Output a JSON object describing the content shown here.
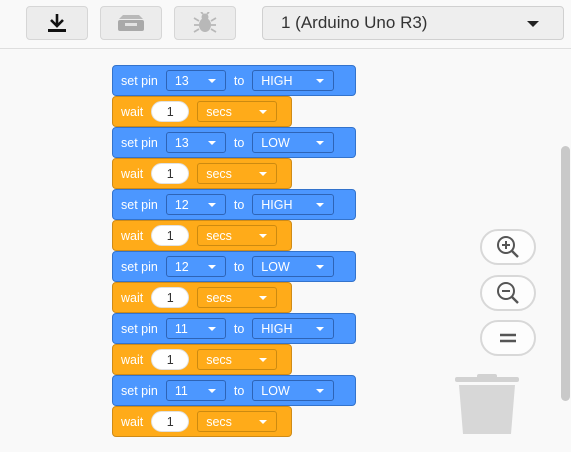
{
  "toolbar": {
    "upload_icon": "download-arrow-icon",
    "serial_icon": "serial-monitor-icon",
    "debug_icon": "bug-icon",
    "device_selector": "1 (Arduino Uno R3)"
  },
  "blocks": [
    {
      "type": "set_pin",
      "label": "set pin",
      "pin": "13",
      "to": "to",
      "state": "HIGH"
    },
    {
      "type": "wait",
      "label": "wait",
      "value": "1",
      "unit": "secs"
    },
    {
      "type": "set_pin",
      "label": "set pin",
      "pin": "13",
      "to": "to",
      "state": "LOW"
    },
    {
      "type": "wait",
      "label": "wait",
      "value": "1",
      "unit": "secs"
    },
    {
      "type": "set_pin",
      "label": "set pin",
      "pin": "12",
      "to": "to",
      "state": "HIGH"
    },
    {
      "type": "wait",
      "label": "wait",
      "value": "1",
      "unit": "secs"
    },
    {
      "type": "set_pin",
      "label": "set pin",
      "pin": "12",
      "to": "to",
      "state": "LOW"
    },
    {
      "type": "wait",
      "label": "wait",
      "value": "1",
      "unit": "secs"
    },
    {
      "type": "set_pin",
      "label": "set pin",
      "pin": "11",
      "to": "to",
      "state": "HIGH"
    },
    {
      "type": "wait",
      "label": "wait",
      "value": "1",
      "unit": "secs"
    },
    {
      "type": "set_pin",
      "label": "set pin",
      "pin": "11",
      "to": "to",
      "state": "LOW"
    },
    {
      "type": "wait",
      "label": "wait",
      "value": "1",
      "unit": "secs"
    }
  ],
  "zoom": {
    "in_icon": "zoom-in-icon",
    "out_icon": "zoom-out-icon",
    "reset_icon": "zoom-reset-icon",
    "trash_icon": "trash-can-icon"
  },
  "colors": {
    "pin_block": "#4c97ff",
    "wait_block": "#ffab19"
  }
}
